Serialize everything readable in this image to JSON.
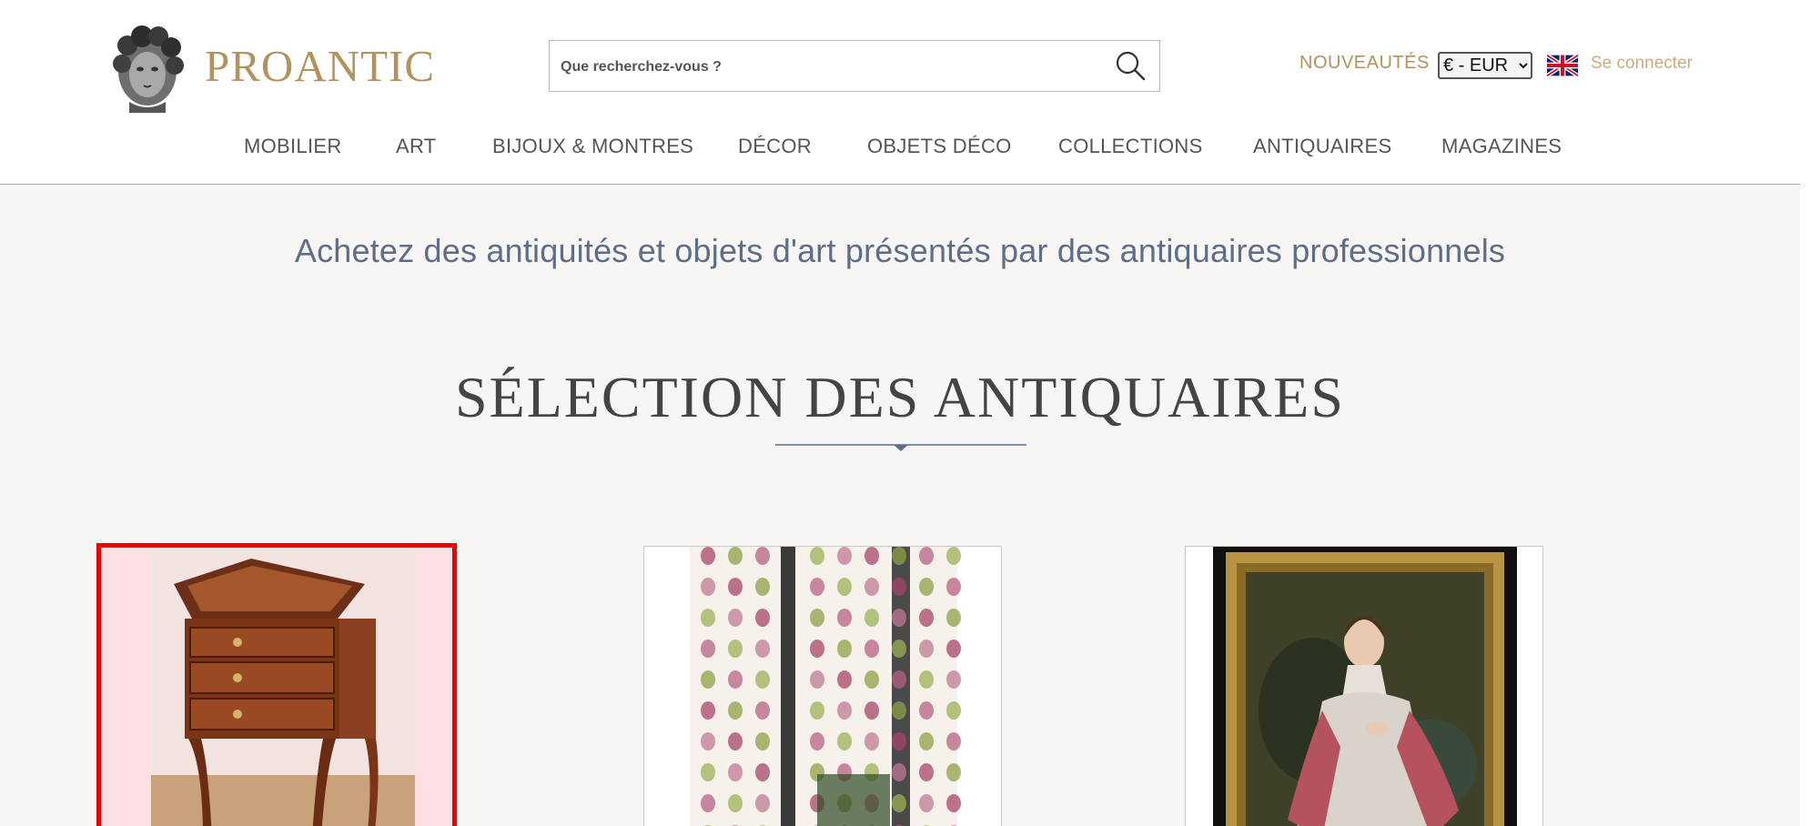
{
  "brand": {
    "name": "PROANTIC",
    "color": "#b2935c"
  },
  "search": {
    "placeholder": "Que recherchez-vous ?",
    "value": ""
  },
  "header_links": {
    "new_label": "NOUVEAUTÉS",
    "currency_selected": "€ - EUR",
    "currency_options": [
      "€ - EUR"
    ],
    "language_icon": "uk-flag-icon",
    "login_label": "Se connecter"
  },
  "nav": {
    "items": [
      {
        "label": "MOBILIER"
      },
      {
        "label": "ART"
      },
      {
        "label": "BIJOUX & MONTRES"
      },
      {
        "label": "DÉCOR"
      },
      {
        "label": "OBJETS DÉCO"
      },
      {
        "label": "COLLECTIONS"
      },
      {
        "label": "ANTIQUAIRES"
      },
      {
        "label": "MAGAZINES"
      }
    ]
  },
  "main": {
    "tagline": "Achetez des antiquités et objets d'art présentés par des antiquaires professionnels",
    "section_title": "SÉLECTION DES ANTIQUAIRES",
    "products": [
      {
        "image": "night-stand-photo",
        "highlighted": true
      },
      {
        "image": "floral-curtain-photo",
        "highlighted": false
      },
      {
        "image": "portrait-painting-photo",
        "highlighted": false
      }
    ]
  },
  "colors": {
    "accent_gold": "#b2935c",
    "tagline_blue": "#5d6e86",
    "highlight_red": "#ec0000",
    "background": "#f7f6f4"
  }
}
